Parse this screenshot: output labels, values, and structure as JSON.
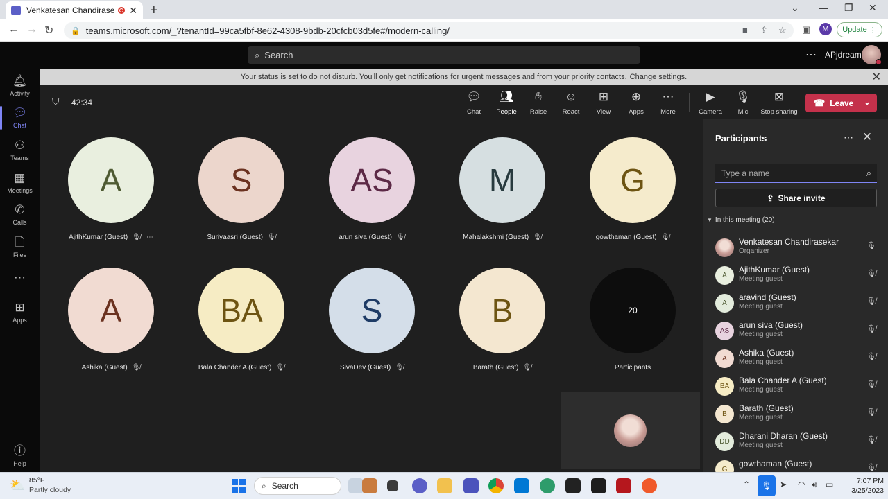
{
  "browser": {
    "tab_title": "Venkatesan Chandirasekar's",
    "tab_close": "✕",
    "new_tab": "+",
    "url": "teams.microsoft.com/_?tenantId=99ca5fbf-8e62-4308-9bdb-20cfcb03d5fe#/modern-calling/",
    "profile_initial": "M",
    "update_label": "Update"
  },
  "teams_header": {
    "search_placeholder": "Search",
    "org_name": "APjdream"
  },
  "rail": [
    {
      "label": "Activity",
      "icon": "bell-icon"
    },
    {
      "label": "Chat",
      "icon": "chat-icon"
    },
    {
      "label": "Teams",
      "icon": "teams-icon"
    },
    {
      "label": "Meetings",
      "icon": "calendar-icon"
    },
    {
      "label": "Calls",
      "icon": "phone-icon"
    },
    {
      "label": "Files",
      "icon": "file-icon"
    },
    {
      "label": "Apps",
      "icon": "apps-icon"
    },
    {
      "label": "Help",
      "icon": "help-icon"
    }
  ],
  "banner": {
    "text": "Your status is set to do not disturb. You'll only get notifications for urgent messages and from your priority contacts.",
    "link": "Change settings."
  },
  "meeting": {
    "timer": "42:34",
    "toolbar": {
      "chat": "Chat",
      "people": "People",
      "raise": "Raise",
      "react": "React",
      "view": "View",
      "apps": "Apps",
      "more": "More",
      "camera": "Camera",
      "mic": "Mic",
      "stop_sharing": "Stop sharing",
      "leave": "Leave"
    },
    "tiles": [
      {
        "initials": "A",
        "name": "AjithKumar (Guest)",
        "bg": "#e9efdf",
        "fg": "#4e5a32"
      },
      {
        "initials": "S",
        "name": "Suriyaasri (Guest)",
        "bg": "#ecd6cc",
        "fg": "#6b3220"
      },
      {
        "initials": "AS",
        "name": "arun siva (Guest)",
        "bg": "#e8d3df",
        "fg": "#5c2946"
      },
      {
        "initials": "M",
        "name": "Mahalakshmi (Guest)",
        "bg": "#d6dfe1",
        "fg": "#283a3e"
      },
      {
        "initials": "G",
        "name": "gowthaman (Guest)",
        "bg": "#f5ebcc",
        "fg": "#6d5412"
      },
      {
        "initials": "A",
        "name": "Ashika (Guest)",
        "bg": "#f1dbd2",
        "fg": "#6b3220"
      },
      {
        "initials": "BA",
        "name": "Bala Chander A (Guest)",
        "bg": "#f6ecc4",
        "fg": "#6d5412"
      },
      {
        "initials": "S",
        "name": "SivaDev (Guest)",
        "bg": "#d4dee9",
        "fg": "#1e3b66"
      },
      {
        "initials": "B",
        "name": "Barath (Guest)",
        "bg": "#f4e7d0",
        "fg": "#6d5412"
      }
    ],
    "overflow": {
      "count": "20",
      "label": "Participants"
    }
  },
  "participants_pane": {
    "title": "Participants",
    "search_placeholder": "Type a name",
    "share_invite": "Share invite",
    "section_label": "In this meeting (20)",
    "people": [
      {
        "initials": "",
        "name": "Venkatesan Chandirasekar",
        "role": "Organizer",
        "photo": true,
        "bg": "#c79a93",
        "fg": "#fff"
      },
      {
        "initials": "A",
        "name": "AjithKumar (Guest)",
        "role": "Meeting guest",
        "bg": "#e9efdf",
        "fg": "#4e5a32"
      },
      {
        "initials": "A",
        "name": "aravind (Guest)",
        "role": "Meeting guest",
        "bg": "#e3ecdc",
        "fg": "#4e5a32"
      },
      {
        "initials": "AS",
        "name": "arun siva (Guest)",
        "role": "Meeting guest",
        "bg": "#e8d3df",
        "fg": "#5c2946"
      },
      {
        "initials": "A",
        "name": "Ashika (Guest)",
        "role": "Meeting guest",
        "bg": "#f1dbd2",
        "fg": "#6b3220"
      },
      {
        "initials": "BA",
        "name": "Bala Chander A (Guest)",
        "role": "Meeting guest",
        "bg": "#f6ecc4",
        "fg": "#6d5412"
      },
      {
        "initials": "B",
        "name": "Barath (Guest)",
        "role": "Meeting guest",
        "bg": "#f4e7d0",
        "fg": "#6d5412"
      },
      {
        "initials": "DD",
        "name": "Dharani Dharan (Guest)",
        "role": "Meeting guest",
        "bg": "#e3ecdc",
        "fg": "#4e5a32"
      },
      {
        "initials": "G",
        "name": "gowthaman (Guest)",
        "role": "Meeting guest",
        "bg": "#f5ebcc",
        "fg": "#6d5412"
      }
    ]
  },
  "taskbar": {
    "temperature": "85°F",
    "weather": "Partly cloudy",
    "search": "Search",
    "time": "7:07 PM",
    "date": "3/25/2023"
  }
}
